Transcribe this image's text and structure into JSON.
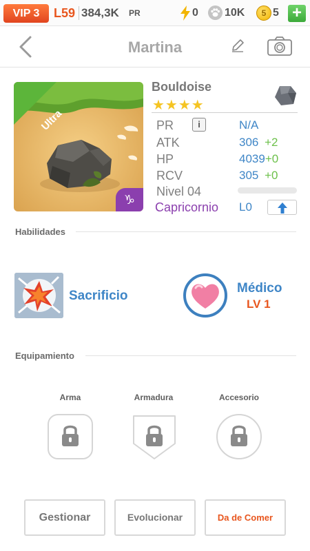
{
  "status": {
    "vip": "VIP 3",
    "level": "L59",
    "power": "384,3K",
    "power_unit": "PR",
    "energy": "0",
    "paws": "10K",
    "coin_icon_text": "5",
    "coins": "5",
    "add_label": "+"
  },
  "nav": {
    "title": "Martina",
    "icons": [
      "back-arrow-icon",
      "pencil-icon",
      "camera-icon"
    ]
  },
  "monster": {
    "ribbon": "Ultra",
    "zodiac_symbol": "♑",
    "name": "Bouldoise",
    "stars": "★★★★",
    "stats": {
      "pr_label": "PR",
      "pr_value": "N/A",
      "info_icon_text": "i",
      "atk_label": "ATK",
      "atk_value": "306",
      "atk_bonus": "+2",
      "hp_label": "HP",
      "hp_value": "4039",
      "hp_bonus": "+0",
      "rcv_label": "RCV",
      "rcv_value": "305",
      "rcv_bonus": "+0",
      "level_label": "Nivel 04",
      "xp_fraction": 0,
      "zodiac_name": "Capricornio",
      "rank_label": "L0"
    }
  },
  "abilities": {
    "title": "Habilidades",
    "active": {
      "name": "Sacrificio"
    },
    "passive": {
      "name": "Médico",
      "level": "LV 1"
    }
  },
  "equipment": {
    "title": "Equipamiento",
    "slots": [
      {
        "label": "Arma",
        "locked": true
      },
      {
        "label": "Armadura",
        "locked": true
      },
      {
        "label": "Accesorio",
        "locked": true
      }
    ]
  },
  "actions": {
    "manage": "Gestionar",
    "evolve": "Evolucionar",
    "feed": "Da de Comer"
  },
  "colors": {
    "accent_blue": "#3f86c7",
    "orange": "#e8561e",
    "green": "#6cc04a",
    "zodiac_purple": "#8b3fae",
    "star_gold": "#f5c423"
  }
}
